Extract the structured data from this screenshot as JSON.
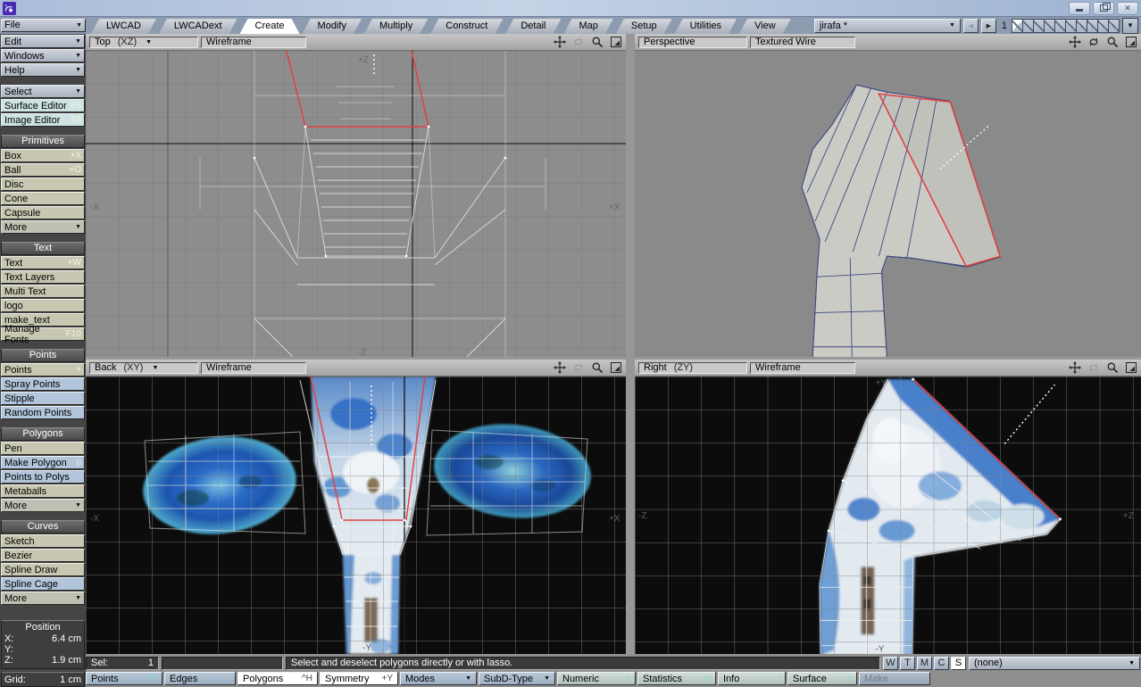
{
  "tabs": {
    "items": [
      "LWCAD",
      "LWCADext",
      "Create",
      "Modify",
      "Multiply",
      "Construct",
      "Detail",
      "Map",
      "Setup",
      "Utilities",
      "View"
    ],
    "active": "Create"
  },
  "header": {
    "object_name": "jirafa *",
    "layer_page": "1",
    "layer_count": 10
  },
  "sidebar": {
    "menus": [
      "File",
      "Edit",
      "Windows",
      "Help"
    ],
    "select_menu": "Select",
    "editors": [
      {
        "label": "Surface Editor",
        "shortcut": "F5"
      },
      {
        "label": "Image Editor",
        "shortcut": "F6"
      }
    ],
    "sections": [
      {
        "title": "Primitives",
        "items": [
          {
            "label": "Box",
            "shortcut": "+X",
            "kind": "tan"
          },
          {
            "label": "Ball",
            "shortcut": "+O",
            "kind": "tan"
          },
          {
            "label": "Disc",
            "kind": "tan"
          },
          {
            "label": "Cone",
            "kind": "tan"
          },
          {
            "label": "Capsule",
            "kind": "tan"
          },
          {
            "label": "More",
            "kind": "more"
          }
        ]
      },
      {
        "title": "Text",
        "items": [
          {
            "label": "Text",
            "shortcut": "+W",
            "kind": "tan"
          },
          {
            "label": "Text Layers",
            "kind": "tan"
          },
          {
            "label": "Multi Text",
            "kind": "tan"
          },
          {
            "label": "logo",
            "kind": "tan"
          },
          {
            "label": "make_text",
            "kind": "tan"
          },
          {
            "label": "Manage Fonts",
            "shortcut": "F10",
            "kind": "tan"
          }
        ]
      },
      {
        "title": "Points",
        "items": [
          {
            "label": "Points",
            "shortcut": "+",
            "kind": "tan"
          },
          {
            "label": "Spray Points",
            "kind": "blue"
          },
          {
            "label": "Stipple",
            "kind": "blue"
          },
          {
            "label": "Random Points",
            "kind": "blue"
          }
        ]
      },
      {
        "title": "Polygons",
        "items": [
          {
            "label": "Pen",
            "kind": "tan"
          },
          {
            "label": "Make Polygon",
            "shortcut": "p",
            "kind": "blue"
          },
          {
            "label": "Points to Polys",
            "kind": "blue"
          },
          {
            "label": "Metaballs",
            "kind": "tan"
          },
          {
            "label": "More",
            "kind": "more"
          }
        ]
      },
      {
        "title": "Curves",
        "items": [
          {
            "label": "Sketch",
            "kind": "tan"
          },
          {
            "label": "Bezier",
            "kind": "tan"
          },
          {
            "label": "Spline Draw",
            "kind": "tan"
          },
          {
            "label": "Spline Cage",
            "kind": "blue"
          },
          {
            "label": "More",
            "kind": "more"
          }
        ]
      }
    ],
    "position": {
      "title": "Position",
      "rows": [
        {
          "label": "X:",
          "value": "6.4 cm"
        },
        {
          "label": "Y:",
          "value": ""
        },
        {
          "label": "Z:",
          "value": "1.9 cm"
        }
      ]
    },
    "grid_label": "Grid:",
    "grid_value": "1 cm"
  },
  "viewports": {
    "top_left": {
      "view": "Top",
      "axis": "(XZ)",
      "mode": "Wireframe",
      "labels": {
        "top": "+Z",
        "bottom": "-Z",
        "left": "-X",
        "right": "+X"
      }
    },
    "top_right": {
      "view": "Perspective",
      "mode": "Textured Wire"
    },
    "bottom_left": {
      "view": "Back",
      "axis": "(XY)",
      "mode": "Wireframe",
      "labels": {
        "left": "-X",
        "right": "+X",
        "bottom": "-Y"
      }
    },
    "bottom_right": {
      "view": "Right",
      "axis": "(ZY)",
      "mode": "Wireframe",
      "labels": {
        "top": "+Y",
        "bottom": "-Y",
        "left": "-Z",
        "right": "+Z"
      }
    }
  },
  "status": {
    "sel_label": "Sel:",
    "sel_value": "1",
    "message": "Select and deselect polygons directly or with lasso.",
    "vmaps": [
      "W",
      "T",
      "M",
      "C",
      "S"
    ],
    "active_vmap": "S",
    "vmap_selector": "(none)"
  },
  "toolbar": {
    "buttons": [
      {
        "label": "Points",
        "shortcut": "^G",
        "kind": "blue"
      },
      {
        "label": "Edges",
        "kind": "blue"
      },
      {
        "label": "Polygons",
        "shortcut": "^H",
        "kind": "active"
      },
      {
        "label": "Symmetry",
        "shortcut": "+Y",
        "kind": "active"
      },
      {
        "label": "Modes",
        "kind": "blue",
        "dropdown": true
      },
      {
        "label": "SubD-Type",
        "kind": "blue",
        "dropdown": true
      },
      {
        "label": "Numeric",
        "shortcut": "n",
        "kind": "green"
      },
      {
        "label": "Statistics",
        "shortcut": "w",
        "kind": "green"
      },
      {
        "label": "Info",
        "shortcut": "i",
        "kind": "green"
      },
      {
        "label": "Surface",
        "shortcut": "q",
        "kind": "green"
      },
      {
        "label": "Make",
        "kind": "disabled"
      }
    ]
  },
  "colors": {
    "selection_red": "#e04343",
    "mesh_edge_blue": "#3c4a7e",
    "tan_button": "#c7c7b2",
    "blue_button": "#b2c5da"
  }
}
